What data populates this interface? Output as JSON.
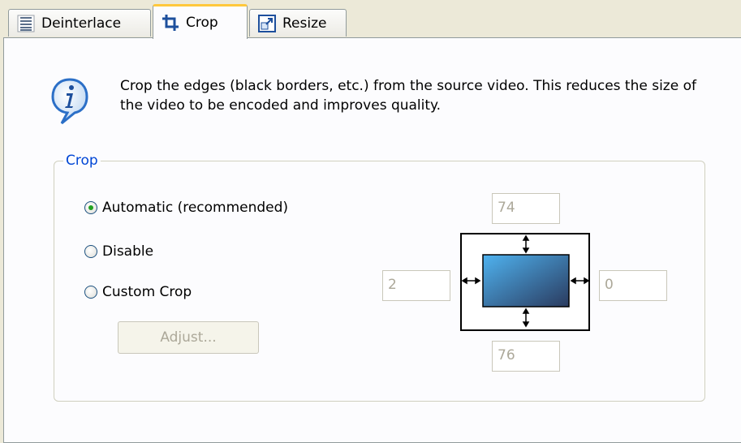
{
  "tabs": [
    {
      "label": "Deinterlace",
      "icon": "deinterlace-icon",
      "active": false
    },
    {
      "label": "Crop",
      "icon": "crop-icon",
      "active": true
    },
    {
      "label": "Resize",
      "icon": "resize-icon",
      "active": false
    }
  ],
  "info": {
    "icon": "info-icon",
    "text": "Crop the edges (black borders, etc.) from the source video. This reduces the size of the video to be encoded and improves quality."
  },
  "crop_group": {
    "legend": "Crop",
    "options": [
      {
        "label": "Automatic (recommended)",
        "checked": true
      },
      {
        "label": "Disable",
        "checked": false
      },
      {
        "label": "Custom Crop",
        "checked": false
      }
    ],
    "adjust_label": "Adjust...",
    "values": {
      "top": "74",
      "left": "2",
      "right": "0",
      "bottom": "76"
    }
  },
  "colors": {
    "accent": "#0046d5",
    "tab_highlight": "#ffc83c",
    "radio_check": "#21a121"
  }
}
